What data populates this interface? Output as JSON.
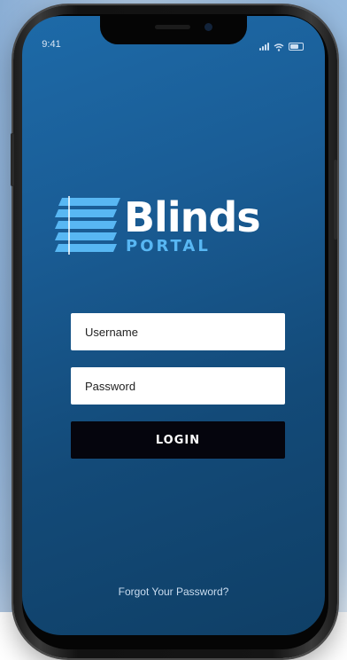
{
  "status_bar": {
    "time": "9:41"
  },
  "logo": {
    "brand": "Blinds",
    "subtitle": "PORTAL"
  },
  "login_form": {
    "username_placeholder": "Username",
    "password_placeholder": "Password",
    "login_label": "LOGIN",
    "forgot_password_label": "Forgot Your Password?"
  },
  "colors": {
    "screen_top": "#1d6aa8",
    "screen_bottom": "#0f3f66",
    "logo_accent": "#58b7f3",
    "login_button_bg": "#05050d"
  },
  "icons": [
    "signal-icon",
    "wifi-icon",
    "battery-icon",
    "blinds-logo-icon"
  ]
}
